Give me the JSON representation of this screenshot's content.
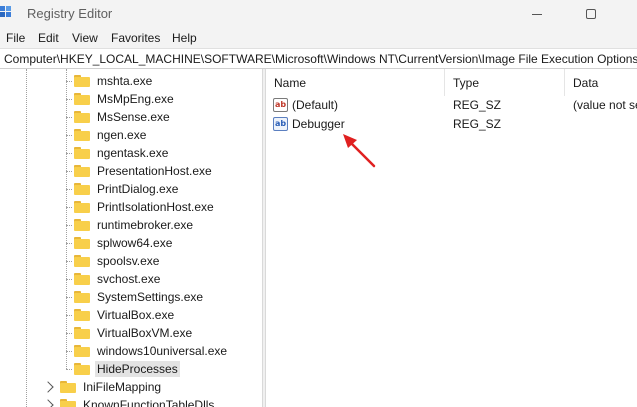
{
  "window": {
    "title": "Registry Editor"
  },
  "menu": [
    "File",
    "Edit",
    "View",
    "Favorites",
    "Help"
  ],
  "address": "Computer\\HKEY_LOCAL_MACHINE\\SOFTWARE\\Microsoft\\Windows NT\\CurrentVersion\\Image File Execution Options\\Hi",
  "tree": {
    "items": [
      "mshta.exe",
      "MsMpEng.exe",
      "MsSense.exe",
      "ngen.exe",
      "ngentask.exe",
      "PresentationHost.exe",
      "PrintDialog.exe",
      "PrintIsolationHost.exe",
      "runtimebroker.exe",
      "splwow64.exe",
      "spoolsv.exe",
      "svchost.exe",
      "SystemSettings.exe",
      "VirtualBox.exe",
      "VirtualBoxVM.exe",
      "windows10universal.exe",
      "HideProcesses"
    ],
    "selected": "HideProcesses",
    "parent_siblings": [
      "IniFileMapping",
      "KnownFunctionTableDlls"
    ]
  },
  "list": {
    "headers": {
      "name": "Name",
      "type": "Type",
      "data": "Data"
    },
    "rows": [
      {
        "name": "(Default)",
        "type": "REG_SZ",
        "data": "(value not se",
        "icon": "string-value-icon"
      },
      {
        "name": "Debugger",
        "type": "REG_SZ",
        "data": "",
        "icon": "string-value-icon"
      }
    ]
  },
  "annotation": {
    "color": "#e02020",
    "icon": "red-arrow-icon"
  }
}
